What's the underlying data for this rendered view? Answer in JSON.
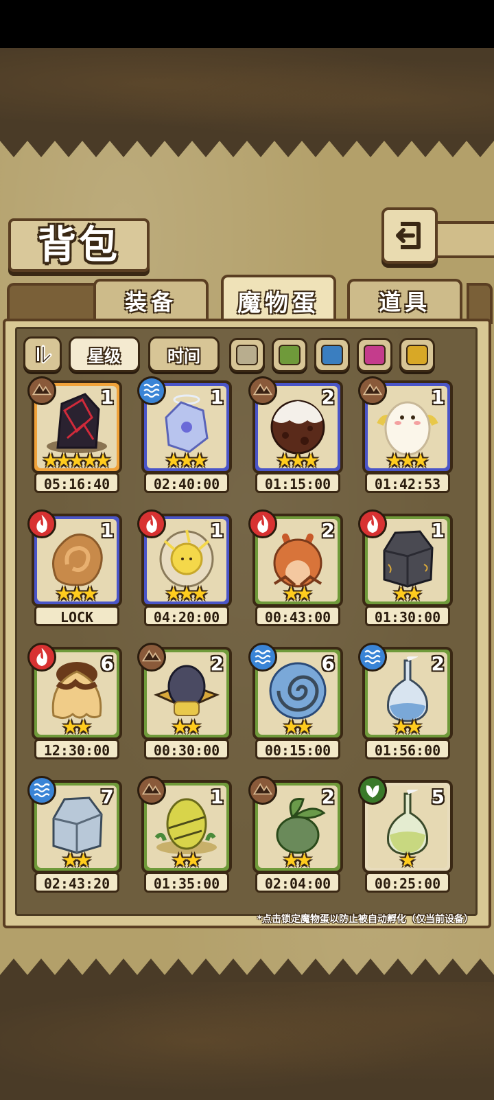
{
  "title": "背包",
  "tabs": [
    {
      "label": "装备",
      "active": false
    },
    {
      "label": "魔物蛋",
      "active": true
    },
    {
      "label": "道具",
      "active": false
    }
  ],
  "sort_buttons": [
    {
      "label": "星级",
      "active": true
    },
    {
      "label": "时间",
      "active": false
    }
  ],
  "color_filters": [
    "#b8ad8e",
    "#6f9a3a",
    "#3a7ec0",
    "#c43c8c",
    "#d8a826"
  ],
  "footer_note": "*点击锁定魔物蛋以防止被自动孵化（仅当前设备）",
  "rarity_colors": {
    "gold": "#f0a23a",
    "blue": "#4a55c8",
    "green": "#6f9a3a",
    "white": "#e8dcbc"
  },
  "element_colors": {
    "earth": "#8a5a3a",
    "water": "#3a84d6",
    "fire": "#d83232",
    "leaf": "#3a7a2a"
  },
  "eggs": [
    {
      "element": "earth",
      "count": "1",
      "stars": 5,
      "rarity": "gold",
      "timer": "05:16:40",
      "egg": "dark-crystal"
    },
    {
      "element": "water",
      "count": "1",
      "stars": 3,
      "rarity": "blue",
      "timer": "02:40:00",
      "egg": "ice-crystal"
    },
    {
      "element": "earth",
      "count": "2",
      "stars": 3,
      "rarity": "blue",
      "timer": "01:15:00",
      "egg": "chocolate"
    },
    {
      "element": "earth",
      "count": "1",
      "stars": 3,
      "rarity": "blue",
      "timer": "01:42:53",
      "egg": "fluffy"
    },
    {
      "element": "fire",
      "count": "1",
      "stars": 3,
      "rarity": "blue",
      "timer": "LOCK",
      "egg": "flame-swirl"
    },
    {
      "element": "fire",
      "count": "1",
      "stars": 3,
      "rarity": "blue",
      "timer": "04:20:00",
      "egg": "sun"
    },
    {
      "element": "fire",
      "count": "2",
      "stars": 2,
      "rarity": "green",
      "timer": "00:43:00",
      "egg": "fox"
    },
    {
      "element": "fire",
      "count": "1",
      "stars": 2,
      "rarity": "green",
      "timer": "01:30:00",
      "egg": "rock"
    },
    {
      "element": "fire",
      "count": "6",
      "stars": 2,
      "rarity": "green",
      "timer": "12:30:00",
      "egg": "pudding"
    },
    {
      "element": "earth",
      "count": "2",
      "stars": 2,
      "rarity": "green",
      "timer": "00:30:00",
      "egg": "hat"
    },
    {
      "element": "water",
      "count": "6",
      "stars": 2,
      "rarity": "green",
      "timer": "00:15:00",
      "egg": "shell"
    },
    {
      "element": "water",
      "count": "2",
      "stars": 2,
      "rarity": "green",
      "timer": "01:56:00",
      "egg": "flask-blue"
    },
    {
      "element": "water",
      "count": "7",
      "stars": 2,
      "rarity": "green",
      "timer": "02:43:20",
      "egg": "ice-rock"
    },
    {
      "element": "earth",
      "count": "1",
      "stars": 2,
      "rarity": "green",
      "timer": "01:35:00",
      "egg": "cactus"
    },
    {
      "element": "earth",
      "count": "2",
      "stars": 2,
      "rarity": "green",
      "timer": "02:04:00",
      "egg": "sprout"
    },
    {
      "element": "leaf",
      "count": "5",
      "stars": 1,
      "rarity": "white",
      "timer": "00:25:00",
      "egg": "flask-green"
    }
  ]
}
